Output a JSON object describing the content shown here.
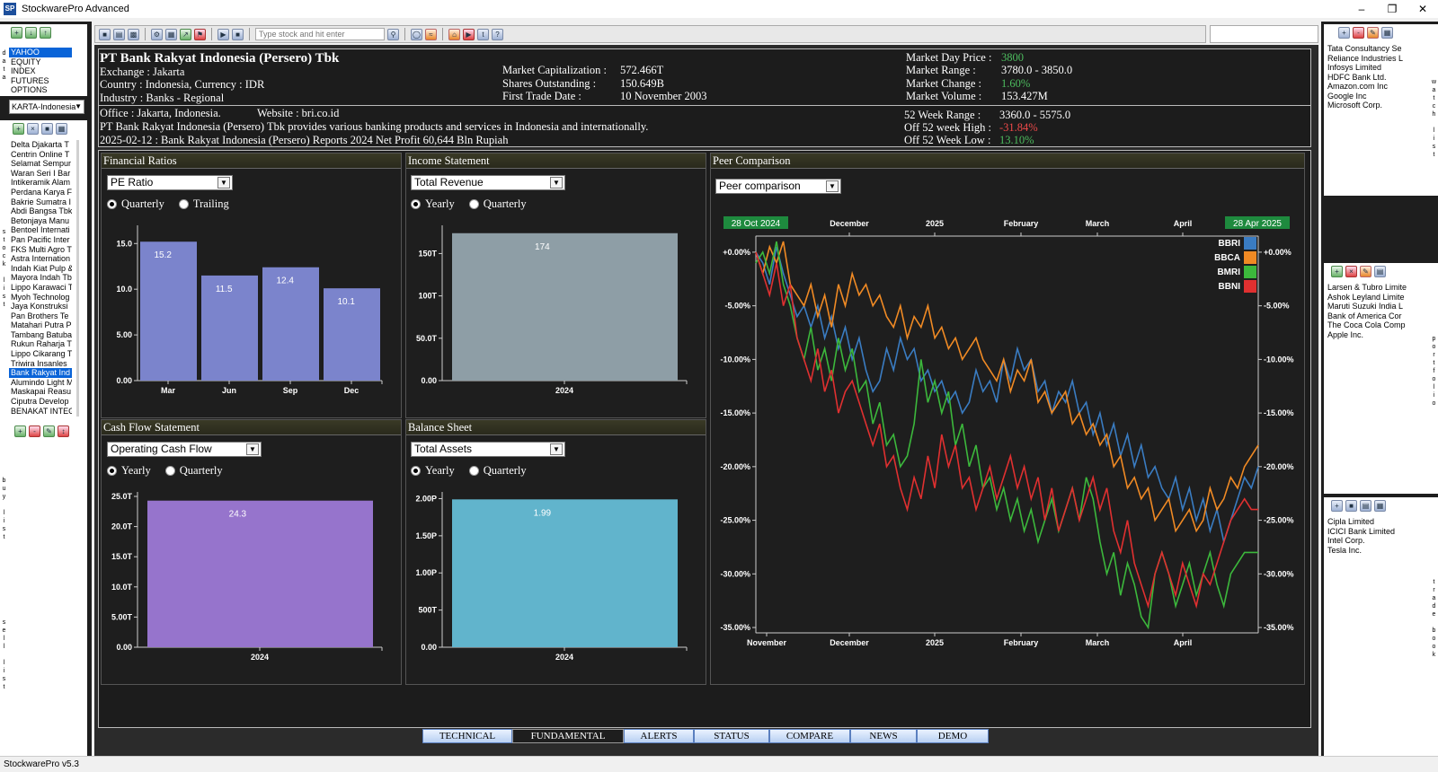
{
  "window": {
    "title": "StockwarePro Advanced",
    "status": "StockwarePro v5.3"
  },
  "left": {
    "markets": [
      "YAHOO",
      "EQUITY",
      "INDEX",
      "FUTURES",
      "OPTIONS"
    ],
    "exchange_select": "KARTA-Indonesia",
    "stocks": [
      "Delta Djakarta T",
      "Centrin Online T",
      "Selamat Sempur",
      "Waran Seri I Bar",
      "Intikeramik Alam",
      "Perdana Karya F",
      "Bakrie Sumatra I",
      "Abdi Bangsa Tbk",
      "Betonjaya Manu",
      "Bentoel Internati",
      "Pan Pacific Inter",
      "FKS Multi Agro T",
      "Astra Internation",
      "Indah Kiat Pulp &",
      "Mayora Indah Tb",
      "Lippo Karawaci T",
      "Myoh Technolog",
      "Jaya Konstruksi",
      "Pan Brothers Te",
      "Matahari Putra P",
      "Tambang Batuba",
      "Rukun Raharja T",
      "Lippo Cikarang T",
      "Triwira Insanles",
      "Bank Rakyat Ind",
      "Alumindo Light M",
      "Maskapai Reasu",
      "Ciputra Develop",
      "BENAKAT INTEG"
    ],
    "selected_stock_index": 24,
    "vlabels": {
      "data": "data",
      "stock_list": "stock list",
      "buy_list": "buy list",
      "sell_list": "sell list"
    }
  },
  "toolbar": {
    "search_placeholder": "Type stock and hit enter"
  },
  "header": {
    "company": "PT Bank Rakyat Indonesia (Persero) Tbk",
    "exchange": "Exchange : Jakarta",
    "country": "Country : Indonesia, Currency : IDR",
    "industry": "Industry : Banks - Regional",
    "mcap_label": "Market Capitalization :",
    "mcap": "572.466T",
    "shares_label": "Shares Outstanding :",
    "shares": "150.649B",
    "ftd_label": "First Trade Date :",
    "ftd": "10 November 2003",
    "price_label": "Market Day Price :",
    "price": "3800",
    "range_label": "Market Range :",
    "range": "3780.0 - 3850.0",
    "change_label": "Market Change :",
    "change": "1.60%",
    "volume_label": "Market Volume :",
    "volume": "153.427M",
    "office": "Office : Jakarta, Indonesia.",
    "website": "Website : bri.co.id",
    "description": "PT Bank Rakyat Indonesia (Persero) Tbk provides various banking products and services in Indonesia and internationally.",
    "news": "2025-02-12 : Bank Rakyat Indonesia (Persero) Reports 2024 Net Profit 60,644 Bln Rupiah",
    "w52_label": "52 Week Range :",
    "w52": "3360.0 - 5575.0",
    "offhigh_label": "Off 52 week High :",
    "offhigh": "-31.84%",
    "offlow_label": "Off 52 Week Low :",
    "offlow": "13.10%"
  },
  "cards": {
    "fin": {
      "title": "Financial Ratios",
      "select": "PE Ratio",
      "r1": "Quarterly",
      "r2": "Trailing"
    },
    "inc": {
      "title": "Income Statement",
      "select": "Total Revenue",
      "r1": "Yearly",
      "r2": "Quarterly"
    },
    "cash": {
      "title": "Cash Flow Statement",
      "select": "Operating Cash Flow",
      "r1": "Yearly",
      "r2": "Quarterly"
    },
    "bal": {
      "title": "Balance Sheet",
      "select": "Total Assets",
      "r1": "Yearly",
      "r2": "Quarterly"
    },
    "peer": {
      "title": "Peer Comparison",
      "select": "Peer comparison"
    }
  },
  "chart_data": [
    {
      "type": "bar",
      "name": "fin",
      "categories": [
        "Mar",
        "Jun",
        "Sep",
        "Dec"
      ],
      "values": [
        15.2,
        11.5,
        12.4,
        10.1
      ],
      "labels": [
        "15.2",
        "11.5",
        "12.4",
        "10.1"
      ],
      "yticks": [
        "0.00",
        "5.00",
        "10.0",
        "15.0"
      ],
      "ylim": [
        0,
        16.5
      ],
      "color": "#7b84cc"
    },
    {
      "type": "bar",
      "name": "inc",
      "categories": [
        "2024"
      ],
      "values": [
        174
      ],
      "labels": [
        "174"
      ],
      "yticks": [
        "0.00",
        "50.0T",
        "100T",
        "150T"
      ],
      "ylim": [
        0,
        178
      ],
      "color": "#8e9ea6"
    },
    {
      "type": "bar",
      "name": "cash",
      "categories": [
        "2024"
      ],
      "values": [
        24.3
      ],
      "labels": [
        "24.3"
      ],
      "yticks": [
        "0.00",
        "5.00T",
        "10.0T",
        "15.0T",
        "20.0T",
        "25.0T"
      ],
      "ylim": [
        0,
        25
      ],
      "color": "#9674cc"
    },
    {
      "type": "bar",
      "name": "bal",
      "categories": [
        "2024"
      ],
      "values": [
        1.99
      ],
      "labels": [
        "1.99"
      ],
      "yticks": [
        "0.00",
        "500T",
        "1.00P",
        "1.50P",
        "2.00P"
      ],
      "ylim": [
        0,
        2.03
      ],
      "color": "#61b4cc"
    },
    {
      "type": "line",
      "name": "peer",
      "start_label": "28 Oct 2024",
      "end_label": "28 Apr 2025",
      "top_ticks": [
        "December",
        "2025",
        "February",
        "March",
        "April"
      ],
      "bottom_ticks": [
        "November",
        "December",
        "2025",
        "February",
        "March",
        "April"
      ],
      "yticks": [
        "+0.00%",
        "-5.00%",
        "-10.00%",
        "-15.00%",
        "-20.00%",
        "-25.00%",
        "-30.00%",
        "-35.00%"
      ],
      "ylim": [
        -35.5,
        1.5
      ],
      "series": [
        {
          "name": "BBRI",
          "color": "#3a7cc2",
          "values": [
            0,
            -1,
            -3,
            0.5,
            -2,
            -4,
            -6,
            -5,
            -7,
            -5,
            -8,
            -6,
            -9,
            -7,
            -10,
            -8,
            -11,
            -13,
            -12,
            -9,
            -11,
            -8,
            -10,
            -9,
            -12,
            -11,
            -13,
            -12,
            -14,
            -13,
            -15,
            -14,
            -11,
            -13,
            -12,
            -14,
            -10,
            -12,
            -9,
            -11,
            -10,
            -13,
            -12,
            -15,
            -13,
            -14,
            -12,
            -15,
            -14,
            -17,
            -15,
            -18,
            -16,
            -19,
            -17,
            -20,
            -18,
            -21,
            -20,
            -22,
            -23,
            -21,
            -24,
            -22,
            -25,
            -23,
            -26,
            -24,
            -27,
            -25,
            -23,
            -21,
            -22,
            -20
          ]
        },
        {
          "name": "BBCA",
          "color": "#f08a24",
          "values": [
            0,
            -2,
            0.5,
            -1,
            1,
            -3,
            -4,
            -5,
            -3,
            -6,
            -4,
            -7,
            -3,
            -5,
            -2,
            -4,
            -3,
            -5,
            -4,
            -6,
            -7,
            -5,
            -8,
            -6,
            -7,
            -5,
            -8,
            -7,
            -9,
            -8,
            -10,
            -9,
            -8,
            -10,
            -11,
            -12,
            -10,
            -13,
            -11,
            -12,
            -10,
            -14,
            -13,
            -15,
            -14,
            -13,
            -16,
            -15,
            -17,
            -16,
            -18,
            -17,
            -20,
            -19,
            -22,
            -21,
            -23,
            -22,
            -25,
            -24,
            -23,
            -26,
            -25,
            -24,
            -26,
            -25,
            -22,
            -24,
            -23,
            -21,
            -22,
            -20,
            -19,
            -18
          ]
        },
        {
          "name": "BMRI",
          "color": "#3cb83c",
          "values": [
            -1,
            0,
            -2,
            1,
            -3,
            -5,
            -8,
            -10,
            -7,
            -11,
            -9,
            -12,
            -8,
            -11,
            -9,
            -13,
            -12,
            -16,
            -14,
            -18,
            -17,
            -20,
            -19,
            -16,
            -10,
            -14,
            -12,
            -15,
            -13,
            -18,
            -16,
            -20,
            -18,
            -22,
            -21,
            -24,
            -22,
            -25,
            -23,
            -26,
            -24,
            -27,
            -25,
            -23,
            -26,
            -24,
            -22,
            -25,
            -21,
            -23,
            -27,
            -30,
            -28,
            -32,
            -29,
            -31,
            -34,
            -35,
            -30,
            -28,
            -30,
            -33,
            -31,
            -29,
            -32,
            -30,
            -28,
            -31,
            -33,
            -30,
            -29,
            -28,
            -28,
            -28
          ]
        },
        {
          "name": "BBNI",
          "color": "#e03030",
          "values": [
            0,
            -2,
            -4,
            -1,
            -5,
            -3,
            -8,
            -10,
            -12,
            -9,
            -13,
            -11,
            -15,
            -13,
            -12,
            -14,
            -16,
            -18,
            -16,
            -20,
            -19,
            -22,
            -24,
            -21,
            -23,
            -19,
            -22,
            -17,
            -20,
            -18,
            -22,
            -21,
            -24,
            -22,
            -20,
            -23,
            -21,
            -19,
            -22,
            -20,
            -23,
            -21,
            -25,
            -22,
            -26,
            -24,
            -22,
            -25,
            -23,
            -21,
            -24,
            -22,
            -26,
            -28,
            -25,
            -29,
            -31,
            -33,
            -30,
            -28,
            -30,
            -32,
            -29,
            -31,
            -33,
            -30,
            -31,
            -29,
            -27,
            -25,
            -24,
            -23,
            -24,
            -24
          ]
        }
      ]
    }
  ],
  "tabs": [
    "TECHNICAL",
    "FUNDAMENTAL",
    "ALERTS",
    "STATUS",
    "COMPARE",
    "NEWS",
    "DEMO"
  ],
  "active_tab": "FUNDAMENTAL",
  "right": {
    "watch": [
      "Tata Consultancy Se",
      "Reliance Industries L",
      "Infosys Limited",
      "HDFC Bank Ltd.",
      "Amazon.com Inc",
      "Google Inc",
      "Microsoft Corp."
    ],
    "portfolio": [
      "Larsen & Tubro Limite",
      "Ashok Leyland Limite",
      "Maruti Suzuki India L",
      "Bank of America Cor",
      "The Coca Cola Comp",
      "Apple Inc."
    ],
    "tradebook": [
      "Cipla Limited",
      "ICICI Bank Limited",
      "Intel Corp.",
      "Tesla Inc."
    ],
    "vlabels": {
      "watch": "watch list",
      "portfolio": "portfolio",
      "tradebook": "trade book"
    }
  }
}
